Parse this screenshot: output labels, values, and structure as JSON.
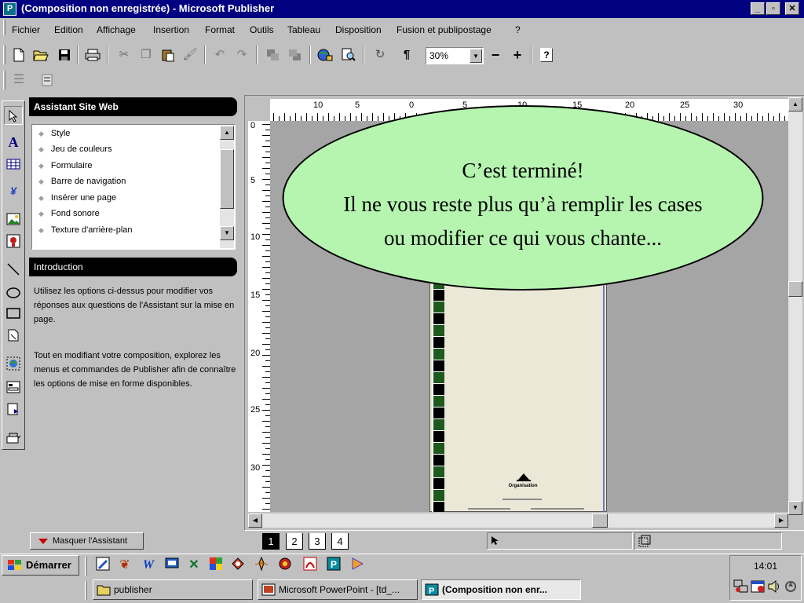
{
  "window": {
    "title": "(Composition non enregistrée) - Microsoft Publisher",
    "app_icon_glyph": "P",
    "controls": {
      "minimize": "_",
      "maximize": "▫",
      "close": "✕"
    }
  },
  "menu": [
    "Fichier",
    "Edition",
    "Affichage",
    "Insertion",
    "Format",
    "Outils",
    "Tableau",
    "Disposition",
    "Fusion et publipostage",
    "?"
  ],
  "toolbar": {
    "zoom": "30%",
    "zoom_out": "−",
    "zoom_in": "+",
    "pilcrow": "¶",
    "help": "?"
  },
  "wizard": {
    "header": "Assistant Site Web",
    "options": [
      "Style",
      "Jeu de couleurs",
      "Formulaire",
      "Barre de navigation",
      "Insérer une page",
      "Fond sonore",
      "Texture d'arrière-plan"
    ],
    "intro_header": "Introduction",
    "intro_p1": "Utilisez les options ci-dessus pour modifier vos réponses aux questions de l'Assistant sur la mise en page.",
    "intro_p2": "Tout en modifiant votre composition, explorez les menus et commandes de Publisher afin de connaître les options de mise en forme disponibles.",
    "hide_button": "Masquer l'Assistant"
  },
  "rulers": {
    "horizontal": [
      "10",
      "5",
      "0",
      "5",
      "10",
      "15",
      "20",
      "25",
      "30"
    ],
    "vertical": [
      "0",
      "5",
      "10",
      "15",
      "20",
      "25",
      "30"
    ]
  },
  "document": {
    "logo_text": "Organisation"
  },
  "callout": {
    "line1": "C’est terminé!",
    "line2": "Il ne vous reste plus qu’à remplir les cases",
    "line3": "ou modifier ce qui vous chante..."
  },
  "pages": [
    "1",
    "2",
    "3",
    "4"
  ],
  "taskbar": {
    "start": "Démarrer",
    "tasks": [
      "publisher",
      "Microsoft PowerPoint - [td_...",
      "(Composition non enr..."
    ],
    "clock": "14:01"
  },
  "colors": {
    "titlebar": "#000080",
    "callout_fill": "#b6f5b0",
    "page_fill": "#ece8d8",
    "strip_green": "#1e5a1e"
  },
  "icons": {
    "tools": [
      "pointer-tool-icon",
      "text-tool-icon",
      "table-tool-icon",
      "wordart-tool-icon",
      "picture-tool-icon",
      "clipart-tool-icon",
      "line-tool-icon",
      "oval-tool-icon",
      "rectangle-tool-icon",
      "custom-shape-tool-icon",
      "hotspot-tool-icon",
      "form-control-tool-icon",
      "html-fragment-tool-icon",
      "design-gallery-tool-icon"
    ]
  }
}
